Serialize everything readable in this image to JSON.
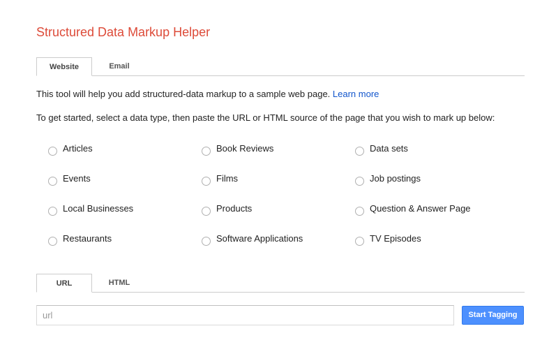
{
  "header": {
    "title": "Structured Data Markup Helper"
  },
  "mode_tabs": [
    {
      "label": "Website",
      "active": true
    },
    {
      "label": "Email",
      "active": false
    }
  ],
  "intro": {
    "text": "This tool will help you add structured-data markup to a sample web page.",
    "link_label": "Learn more"
  },
  "instructions": "To get started, select a data type, then paste the URL or HTML source of the page that you wish to mark up below:",
  "data_types": [
    {
      "label": "Articles",
      "selected": false
    },
    {
      "label": "Book Reviews",
      "selected": false
    },
    {
      "label": "Data sets",
      "selected": false
    },
    {
      "label": "Events",
      "selected": false
    },
    {
      "label": "Films",
      "selected": false
    },
    {
      "label": "Job postings",
      "selected": false
    },
    {
      "label": "Local Businesses",
      "selected": false
    },
    {
      "label": "Products",
      "selected": false
    },
    {
      "label": "Question & Answer Page",
      "selected": false
    },
    {
      "label": "Restaurants",
      "selected": false
    },
    {
      "label": "Software Applications",
      "selected": false
    },
    {
      "label": "TV Episodes",
      "selected": false
    }
  ],
  "source_tabs": [
    {
      "label": "URL",
      "active": true
    },
    {
      "label": "HTML",
      "active": false
    }
  ],
  "url_input": {
    "value": "",
    "placeholder": "url"
  },
  "start_button": {
    "label": "Start Tagging"
  },
  "colors": {
    "title": "#dd4b39",
    "link": "#1155cc",
    "primary_button": "#4d90fe"
  }
}
